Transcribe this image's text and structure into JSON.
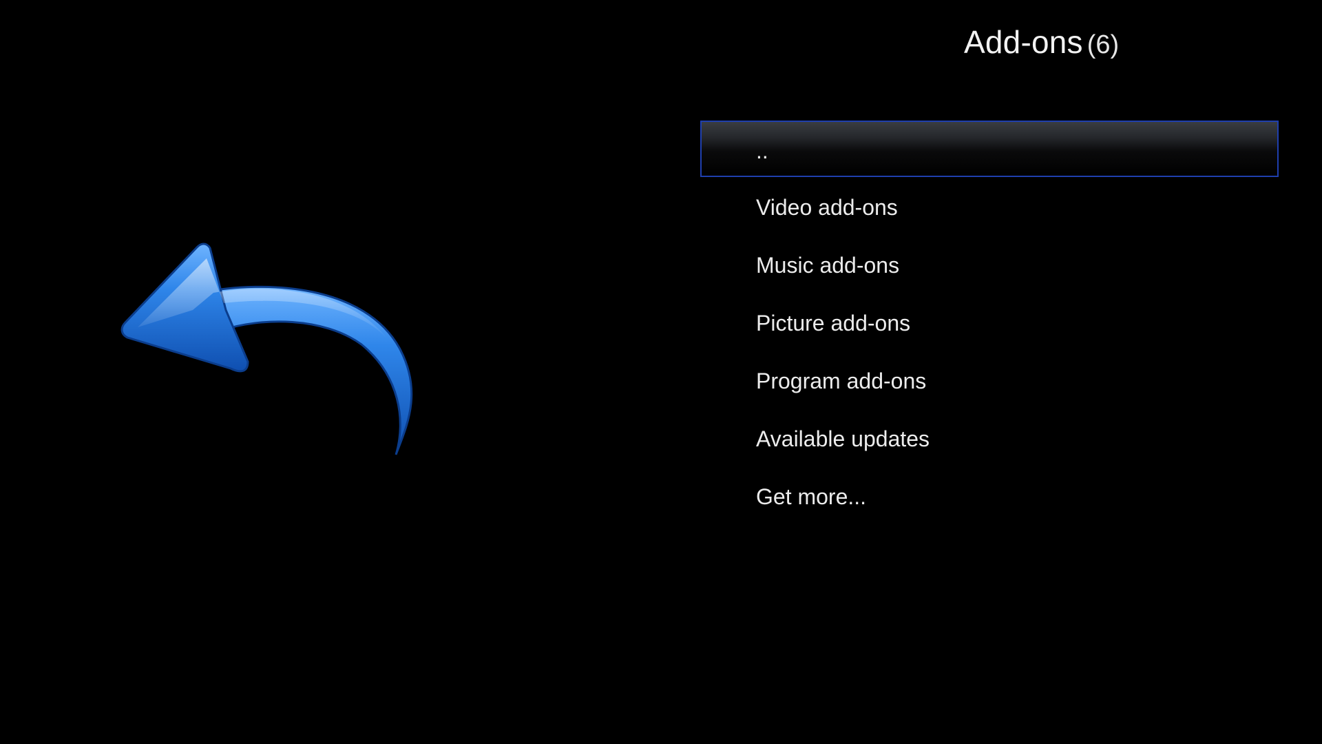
{
  "header": {
    "title": "Add-ons",
    "count": "(6)"
  },
  "list": {
    "items": [
      {
        "label": "..",
        "selected": true
      },
      {
        "label": "Video add-ons",
        "selected": false
      },
      {
        "label": "Music add-ons",
        "selected": false
      },
      {
        "label": "Picture add-ons",
        "selected": false
      },
      {
        "label": "Program add-ons",
        "selected": false
      },
      {
        "label": "Available updates",
        "selected": false
      },
      {
        "label": "Get more...",
        "selected": false
      }
    ]
  },
  "artwork": {
    "icon": "back-arrow-icon",
    "color": "#2a7fe0"
  },
  "colors": {
    "background": "#000000",
    "selection_border": "#1f3fae",
    "text": "#ececec"
  }
}
